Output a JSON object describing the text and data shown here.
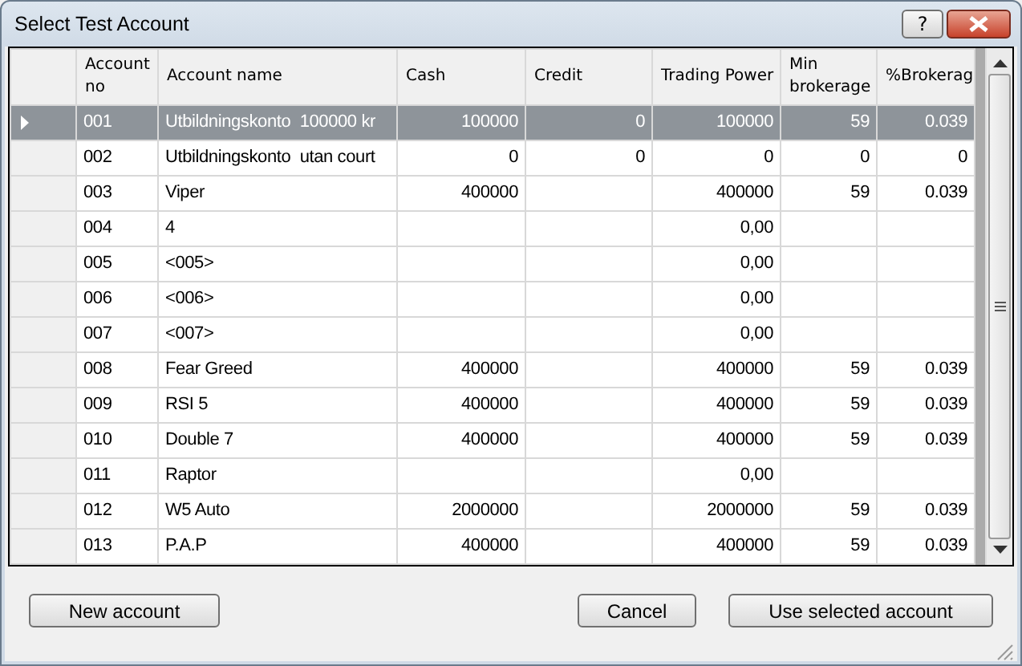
{
  "window": {
    "title": "Select Test Account",
    "help_button": "?"
  },
  "table": {
    "columns": [
      "Account no",
      "Account name",
      "Cash",
      "Credit",
      "Trading Power",
      "Min brokerage",
      "%Brokerag"
    ],
    "rows": [
      {
        "selected": true,
        "account_no": "001",
        "name": "Utbildningskonto  100000 kr",
        "cash": "100000",
        "credit": "0",
        "trading_power": "100000",
        "min_brokerage": "59",
        "pct_brokerage": "0.039"
      },
      {
        "selected": false,
        "account_no": "002",
        "name": "Utbildningskonto  utan court",
        "cash": "0",
        "credit": "0",
        "trading_power": "0",
        "min_brokerage": "0",
        "pct_brokerage": "0"
      },
      {
        "selected": false,
        "account_no": "003",
        "name": "Viper",
        "cash": "400000",
        "trading_power": "400000",
        "min_brokerage": "59",
        "pct_brokerage": "0.039"
      },
      {
        "selected": false,
        "account_no": "004",
        "name": "4",
        "trading_power": "0,00"
      },
      {
        "selected": false,
        "account_no": "005",
        "name": "<005>",
        "trading_power": "0,00"
      },
      {
        "selected": false,
        "account_no": "006",
        "name": "<006>",
        "trading_power": "0,00"
      },
      {
        "selected": false,
        "account_no": "007",
        "name": "<007>",
        "trading_power": "0,00"
      },
      {
        "selected": false,
        "account_no": "008",
        "name": "Fear Greed",
        "cash": "400000",
        "trading_power": "400000",
        "min_brokerage": "59",
        "pct_brokerage": "0.039"
      },
      {
        "selected": false,
        "account_no": "009",
        "name": "RSI 5",
        "cash": "400000",
        "trading_power": "400000",
        "min_brokerage": "59",
        "pct_brokerage": "0.039"
      },
      {
        "selected": false,
        "account_no": "010",
        "name": "Double 7",
        "cash": "400000",
        "trading_power": "400000",
        "min_brokerage": "59",
        "pct_brokerage": "0.039"
      },
      {
        "selected": false,
        "account_no": "011",
        "name": "Raptor",
        "trading_power": "0,00"
      },
      {
        "selected": false,
        "account_no": "012",
        "name": "W5 Auto",
        "cash": "2000000",
        "trading_power": "2000000",
        "min_brokerage": "59",
        "pct_brokerage": "0.039"
      },
      {
        "selected": false,
        "account_no": "013",
        "name": "P.A.P",
        "cash": "400000",
        "trading_power": "400000",
        "min_brokerage": "59",
        "pct_brokerage": "0.039"
      }
    ]
  },
  "buttons": {
    "new_account": "New account",
    "cancel": "Cancel",
    "use_selected": "Use selected account"
  }
}
